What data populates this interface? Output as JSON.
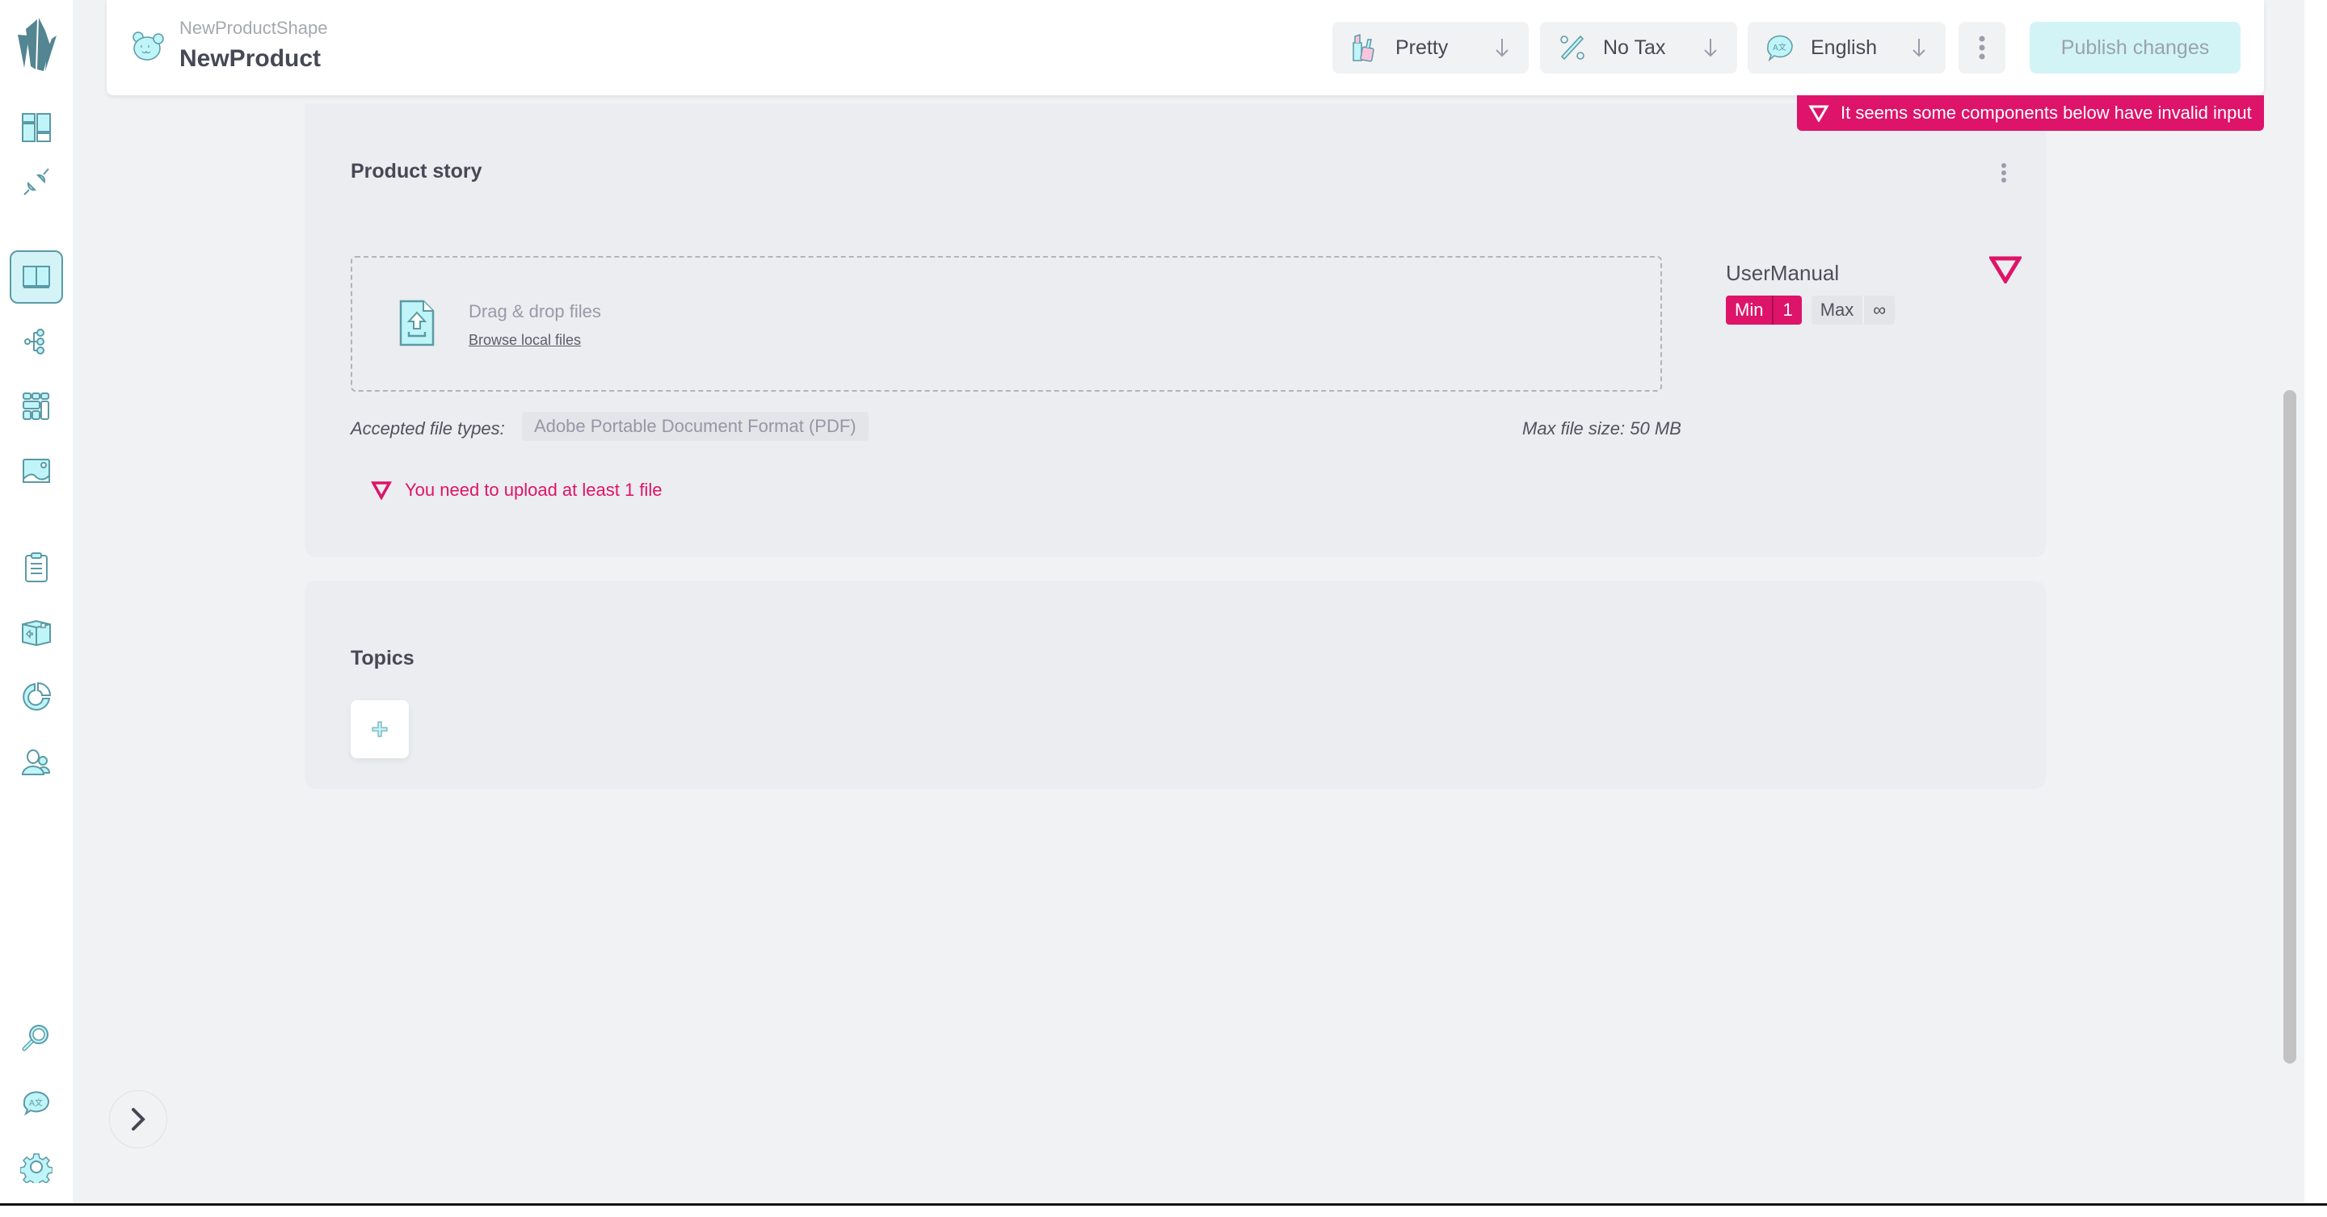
{
  "sidebar": {
    "logo": "crystal-logo",
    "items": [
      {
        "name": "dashboard",
        "icon": "dashboard-layout-icon",
        "active": false
      },
      {
        "name": "integrations",
        "icon": "plug-icon",
        "active": false
      },
      {
        "name": "catalogue",
        "icon": "open-book-icon",
        "active": true
      },
      {
        "name": "shapes",
        "icon": "tree-structure-icon",
        "active": false
      },
      {
        "name": "grids",
        "icon": "grid-layout-icon",
        "active": false
      },
      {
        "name": "media",
        "icon": "image-icon",
        "active": false
      },
      {
        "name": "orders",
        "icon": "clipboard-icon",
        "active": false
      },
      {
        "name": "fulfilment",
        "icon": "box-icon",
        "active": false
      },
      {
        "name": "insights",
        "icon": "pie-chart-icon",
        "active": false
      },
      {
        "name": "customers",
        "icon": "users-icon",
        "active": false
      },
      {
        "name": "search",
        "icon": "magnifier-icon",
        "active": false
      },
      {
        "name": "languages",
        "icon": "translate-bubble-icon",
        "active": false
      },
      {
        "name": "settings",
        "icon": "gear-icon",
        "active": false
      }
    ]
  },
  "header": {
    "shape_name": "NewProductShape",
    "item_name": "NewProduct",
    "avatar_icon": "bear-face-icon",
    "toolbar": {
      "price_variant": {
        "label": "Pretty",
        "icon": "cosmetics-icon"
      },
      "tax": {
        "label": "No Tax",
        "icon": "percent-icon"
      },
      "language": {
        "label": "English",
        "icon": "translate-bubble-icon"
      },
      "more_icon": "kebab-icon",
      "publish_label": "Publish changes"
    },
    "alert": "It seems some components below have invalid input"
  },
  "colors": {
    "accent": "#5b9aa6",
    "accent_light": "#bff5f8",
    "error": "#dd1469",
    "publish_bg": "#d3f4f6"
  },
  "product_story": {
    "title": "Product story",
    "dropzone": {
      "text": "Drag & drop files",
      "browse_label": "Browse local files"
    },
    "accepted_label": "Accepted file types:",
    "accepted_types": [
      "Adobe Portable Document Format (PDF)"
    ],
    "max_size": "Max file size: 50 MB",
    "error": "You need to upload at least 1 file",
    "component": {
      "name": "UserManual",
      "min_label": "Min",
      "min_value": "1",
      "max_label": "Max",
      "max_value": "∞"
    }
  },
  "topics": {
    "title": "Topics",
    "add_icon": "plus-icon"
  },
  "collapse_icon": "chevron-right-icon"
}
